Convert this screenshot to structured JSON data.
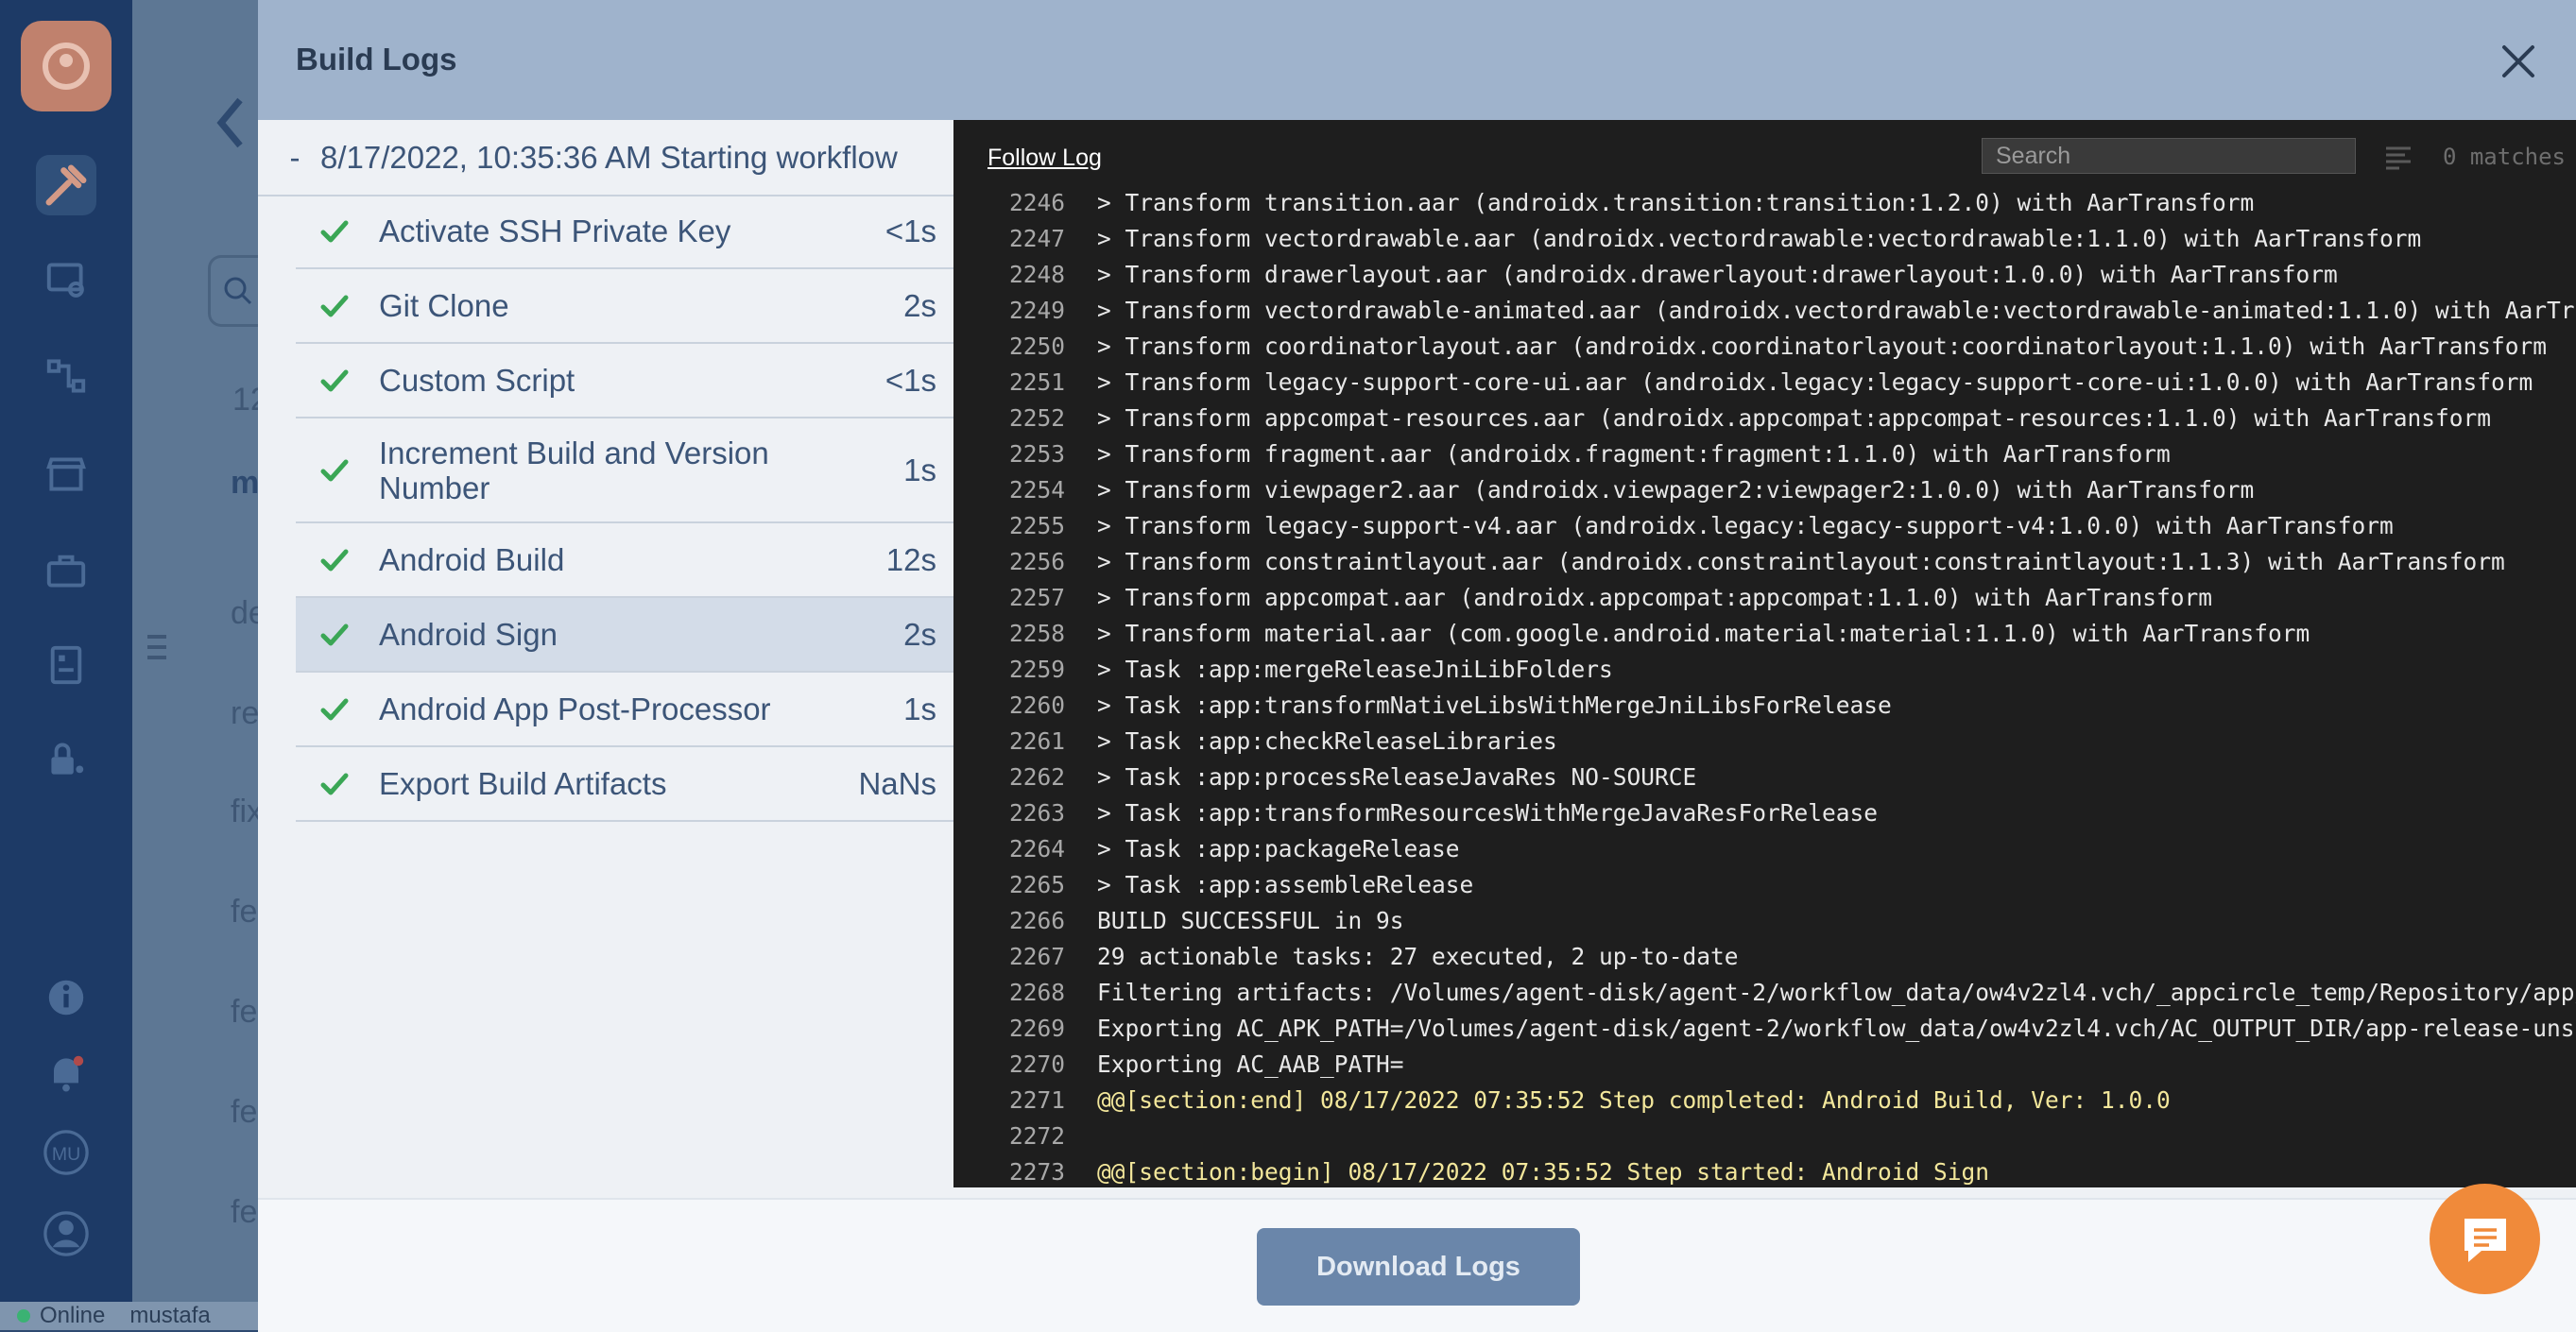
{
  "background": {
    "rail_icons": [
      "build-icon",
      "certificate-icon",
      "distribution-icon",
      "store-icon",
      "briefcase-icon",
      "report-icon",
      "lock-user-icon",
      "info-icon",
      "bell-icon",
      "avatar-icon",
      "profile-icon"
    ],
    "avatar_initials": "MU",
    "status": {
      "online": "Online",
      "user": "mustafa"
    },
    "list_fragments": [
      "12",
      "m",
      "de",
      "re",
      "fix",
      "fe",
      "fe",
      "fe",
      "fe"
    ]
  },
  "modal": {
    "title": "Build Logs",
    "workflow": {
      "collapse_mark": "-",
      "label": "8/17/2022, 10:35:36 AM Starting workflow"
    },
    "steps": [
      {
        "name": "Activate SSH Private Key",
        "duration": "<1s"
      },
      {
        "name": "Git Clone",
        "duration": "2s"
      },
      {
        "name": "Custom Script",
        "duration": "<1s"
      },
      {
        "name": "Increment Build and Version Number",
        "duration": "1s"
      },
      {
        "name": "Android Build",
        "duration": "12s"
      },
      {
        "name": "Android Sign",
        "duration": "2s",
        "selected": true
      },
      {
        "name": "Android App Post-Processor",
        "duration": "1s"
      },
      {
        "name": "Export Build Artifacts",
        "duration": "NaNs"
      }
    ],
    "log": {
      "follow_label": "Follow Log",
      "search_placeholder": "Search",
      "match_count": "0 matches",
      "lines": [
        {
          "num": "2246",
          "text": "> Transform transition.aar (androidx.transition:transition:1.2.0) with AarTransform"
        },
        {
          "num": "2247",
          "text": "> Transform vectordrawable.aar (androidx.vectordrawable:vectordrawable:1.1.0) with AarTransform"
        },
        {
          "num": "2248",
          "text": "> Transform drawerlayout.aar (androidx.drawerlayout:drawerlayout:1.0.0) with AarTransform"
        },
        {
          "num": "2249",
          "text": "> Transform vectordrawable-animated.aar (androidx.vectordrawable:vectordrawable-animated:1.1.0) with AarTransform"
        },
        {
          "num": "2250",
          "text": "> Transform coordinatorlayout.aar (androidx.coordinatorlayout:coordinatorlayout:1.1.0) with AarTransform"
        },
        {
          "num": "2251",
          "text": "> Transform legacy-support-core-ui.aar (androidx.legacy:legacy-support-core-ui:1.0.0) with AarTransform"
        },
        {
          "num": "2252",
          "text": "> Transform appcompat-resources.aar (androidx.appcompat:appcompat-resources:1.1.0) with AarTransform"
        },
        {
          "num": "2253",
          "text": "> Transform fragment.aar (androidx.fragment:fragment:1.1.0) with AarTransform"
        },
        {
          "num": "2254",
          "text": "> Transform viewpager2.aar (androidx.viewpager2:viewpager2:1.0.0) with AarTransform"
        },
        {
          "num": "2255",
          "text": "> Transform legacy-support-v4.aar (androidx.legacy:legacy-support-v4:1.0.0) with AarTransform"
        },
        {
          "num": "2256",
          "text": "> Transform constraintlayout.aar (androidx.constraintlayout:constraintlayout:1.1.3) with AarTransform"
        },
        {
          "num": "2257",
          "text": "> Transform appcompat.aar (androidx.appcompat:appcompat:1.1.0) with AarTransform"
        },
        {
          "num": "2258",
          "text": "> Transform material.aar (com.google.android.material:material:1.1.0) with AarTransform"
        },
        {
          "num": "2259",
          "text": "> Task :app:mergeReleaseJniLibFolders"
        },
        {
          "num": "2260",
          "text": "> Task :app:transformNativeLibsWithMergeJniLibsForRelease"
        },
        {
          "num": "2261",
          "text": "> Task :app:checkReleaseLibraries"
        },
        {
          "num": "2262",
          "text": "> Task :app:processReleaseJavaRes NO-SOURCE"
        },
        {
          "num": "2263",
          "text": "> Task :app:transformResourcesWithMergeJavaResForRelease"
        },
        {
          "num": "2264",
          "text": "> Task :app:packageRelease"
        },
        {
          "num": "2265",
          "text": "> Task :app:assembleRelease"
        },
        {
          "num": "2266",
          "text": "BUILD SUCCESSFUL in 9s"
        },
        {
          "num": "2267",
          "text": "29 actionable tasks: 27 executed, 2 up-to-date"
        },
        {
          "num": "2268",
          "text": "Filtering artifacts: /Volumes/agent-disk/agent-2/workflow_data/ow4v2zl4.vch/_appcircle_temp/Repository/app/build/o"
        },
        {
          "num": "2269",
          "text": "Exporting AC_APK_PATH=/Volumes/agent-disk/agent-2/workflow_data/ow4v2zl4.vch/AC_OUTPUT_DIR/app-release-unsigned.ap"
        },
        {
          "num": "2270",
          "text": "Exporting AC_AAB_PATH="
        },
        {
          "num": "2271",
          "text": "@@[section:end] 08/17/2022 07:35:52 Step completed: Android Build, Ver: 1.0.0",
          "section": true
        },
        {
          "num": "2272",
          "text": ""
        },
        {
          "num": "2273",
          "text": "@@[section:begin] 08/17/2022 07:35:52 Step started: Android Sign",
          "section": true
        }
      ]
    },
    "download_label": "Download Logs"
  },
  "colors": {
    "header": "#9fb3cc",
    "log_bg": "#1e1e1e",
    "section_text": "#f3e79b",
    "check": "#3aa655",
    "download": "#6a86aa",
    "chat": "#f08a3a"
  }
}
